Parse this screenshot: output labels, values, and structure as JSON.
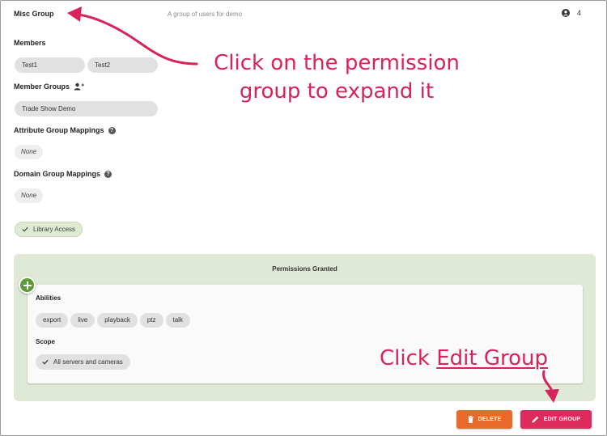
{
  "group": {
    "title": "Misc Group",
    "description": "A group of users for demo",
    "member_count": "4"
  },
  "members": {
    "label": "Members",
    "items": [
      "Test1",
      "Test2"
    ]
  },
  "member_groups": {
    "label": "Member Groups",
    "items": [
      "Trade Show Demo"
    ]
  },
  "attribute_mappings": {
    "label": "Attribute Group Mappings",
    "value": "None"
  },
  "domain_mappings": {
    "label": "Domain Group Mappings",
    "value": "None"
  },
  "library_access": {
    "label": "Library Access"
  },
  "permissions": {
    "title": "Permissions Granted",
    "abilities_label": "Abilities",
    "abilities": [
      "export",
      "live",
      "playback",
      "ptz",
      "talk"
    ],
    "scope_label": "Scope",
    "scope_value": "All servers and cameras"
  },
  "actions": {
    "delete_label": "DELETE",
    "edit_label": "EDIT GROUP"
  },
  "annotations": {
    "expand_hint": "Click on the permission group to expand it",
    "edit_hint_prefix": "Click ",
    "edit_hint_link": "Edit Group"
  },
  "colors": {
    "accent_annotation": "#d8235a",
    "delete_button": "#e56a2b",
    "edit_button": "#dd2a5c",
    "permissions_panel": "#e0e9d6",
    "add_button": "#5c9b38"
  },
  "icons": {
    "member_count": "account-circle-icon",
    "member_groups": "add-person-icon",
    "help": "help-circle-icon",
    "check": "check-icon",
    "add": "plus-circle-icon",
    "delete": "trash-icon",
    "edit": "pencil-icon"
  }
}
